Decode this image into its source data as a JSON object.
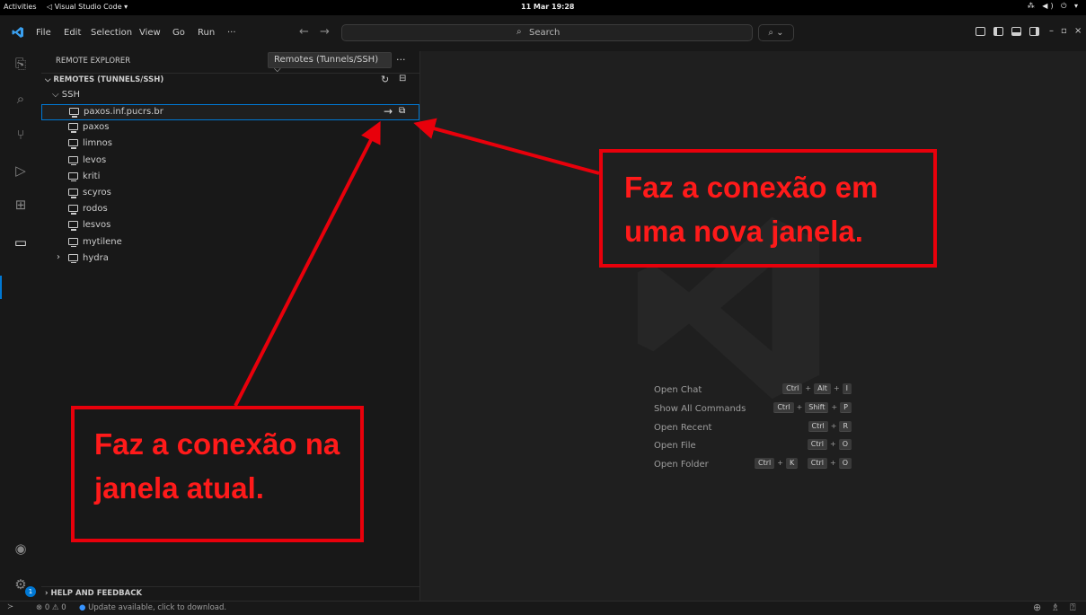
{
  "topbar": {
    "activities": "Activities",
    "app_name": "◁ Visual Studio Code ▾",
    "clock": "11 Mar 19:28",
    "tray": "⁂ ◀) ⏻ ▾"
  },
  "titlebar": {
    "menus": [
      "File",
      "Edit",
      "Selection",
      "View",
      "Go",
      "Run",
      "···"
    ],
    "search_label": "Search",
    "copilot": "⌕ ⌄"
  },
  "sidebar": {
    "title": "REMOTE EXPLORER",
    "remote_select": "Remotes (Tunnels/SSH) ⌵",
    "more": "···",
    "section_label": "⌵ REMOTES (TUNNELS/SSH)",
    "ssh_group": "⌵ SSH",
    "hosts": [
      "paxos.inf.pucrs.br",
      "paxos",
      "limnos",
      "levos",
      "kriti",
      "scyros",
      "rodos",
      "lesvos",
      "mytilene",
      "hydra"
    ],
    "help": "› HELP AND FEEDBACK"
  },
  "editor": {
    "shortcuts": [
      {
        "label": "Open Chat",
        "keys": [
          "Ctrl",
          "Alt",
          "I"
        ]
      },
      {
        "label": "Show All Commands",
        "keys": [
          "Ctrl",
          "Shift",
          "P"
        ]
      },
      {
        "label": "Open Recent",
        "keys": [
          "Ctrl",
          "R"
        ]
      },
      {
        "label": "Open File",
        "keys": [
          "Ctrl",
          "O"
        ]
      },
      {
        "label": "Open Folder",
        "keys": [
          "Ctrl",
          "K",
          "Ctrl",
          "O"
        ],
        "chord": true
      }
    ]
  },
  "statusbar": {
    "remote": "≻",
    "problems": "⊗ 0 ⚠ 0",
    "update_dot": "●",
    "update": "Update available, click to download.",
    "badge_count": "1"
  },
  "annotations": {
    "new_window": "Faz a conexão em uma nova janela.",
    "current_window": "Faz a conexão na janela atual."
  },
  "colors": {
    "accent": "#0078d4",
    "annotation": "#e8000b"
  }
}
